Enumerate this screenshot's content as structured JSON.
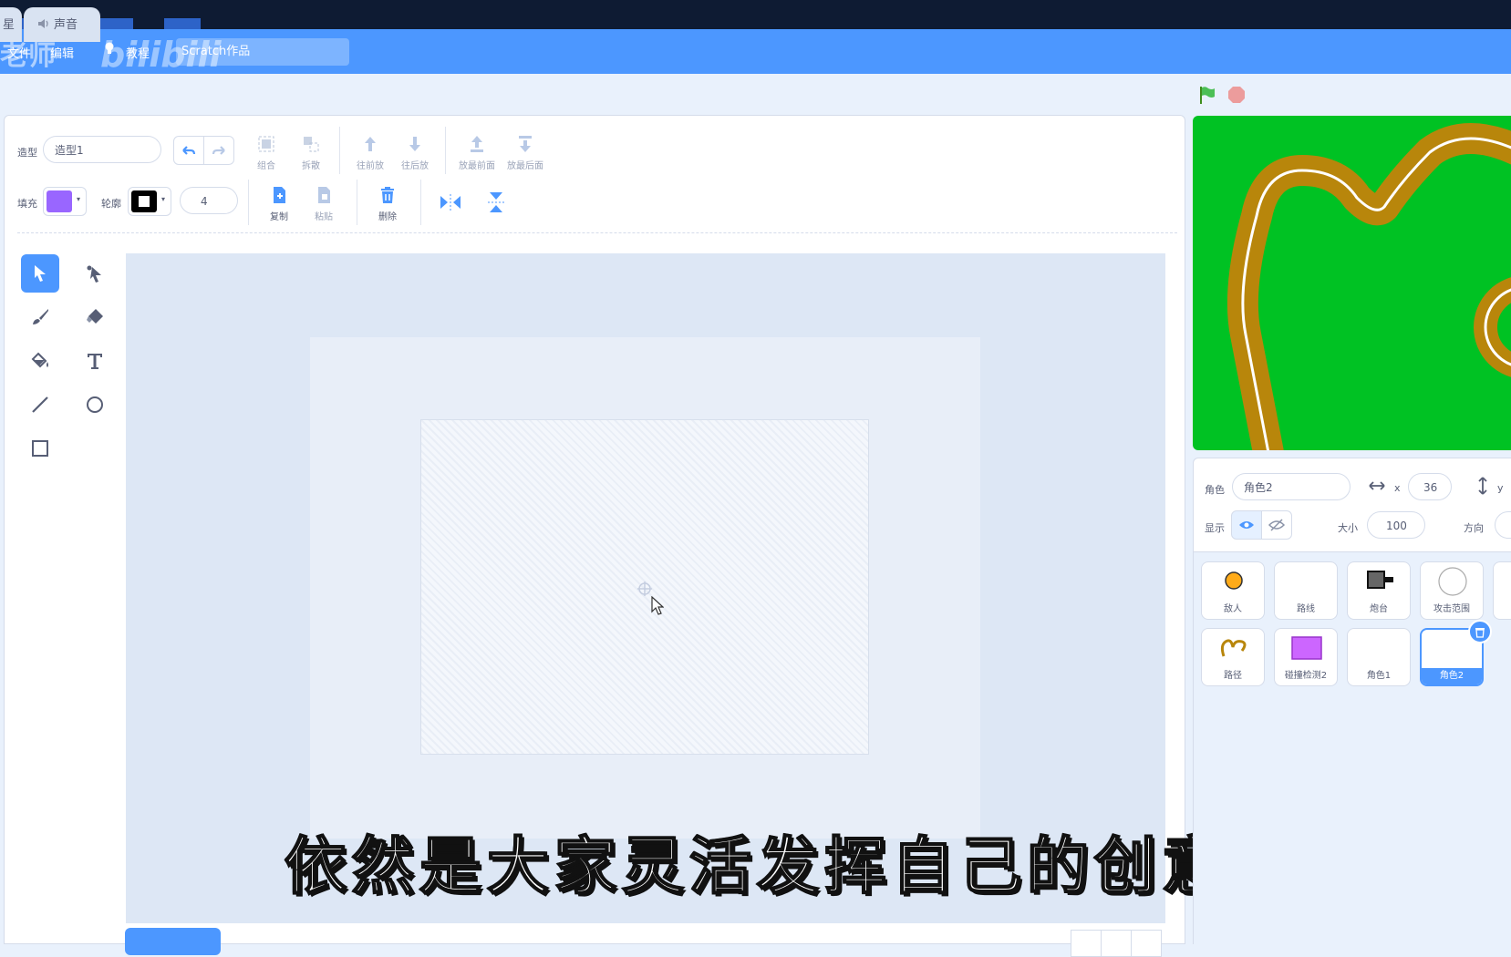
{
  "menubar": {
    "file": "文件",
    "edit": "编辑",
    "tutorials": "教程",
    "project_title": "Scratch作品"
  },
  "watermark": {
    "text": "老师",
    "brand": "bilibili"
  },
  "tabs": {
    "code": "星",
    "sounds": "声音"
  },
  "toolbar": {
    "costume_label": "造型",
    "costume_name": "造型1",
    "group": "组合",
    "ungroup": "拆散",
    "forward": "往前放",
    "backward": "往后放",
    "front": "放最前面",
    "back": "放最后面",
    "fill_label": "填充",
    "fill_color": "#9966ff",
    "outline_label": "轮廓",
    "outline_color": "#000000",
    "outline_width": "4",
    "copy": "复制",
    "paste": "粘贴",
    "delete": "删除"
  },
  "caption": "依然是大家灵活发挥自己的创意",
  "sprite_info": {
    "sprite_label": "角色",
    "sprite_name": "角色2",
    "x_label": "x",
    "x_value": "36",
    "y_label": "y",
    "show_label": "显示",
    "size_label": "大小",
    "size_value": "100",
    "direction_label": "方向"
  },
  "sprites": [
    {
      "name": "敌人"
    },
    {
      "name": "路线"
    },
    {
      "name": "炮台"
    },
    {
      "name": "攻击范围"
    },
    {
      "name": "路径"
    },
    {
      "name": "碰撞检测2"
    },
    {
      "name": "角色1"
    },
    {
      "name": "角色2"
    }
  ],
  "colors": {
    "accent": "#4c97ff",
    "stage_grass": "#00c223",
    "track": "#b8860b",
    "enemy": "#ffab19"
  }
}
